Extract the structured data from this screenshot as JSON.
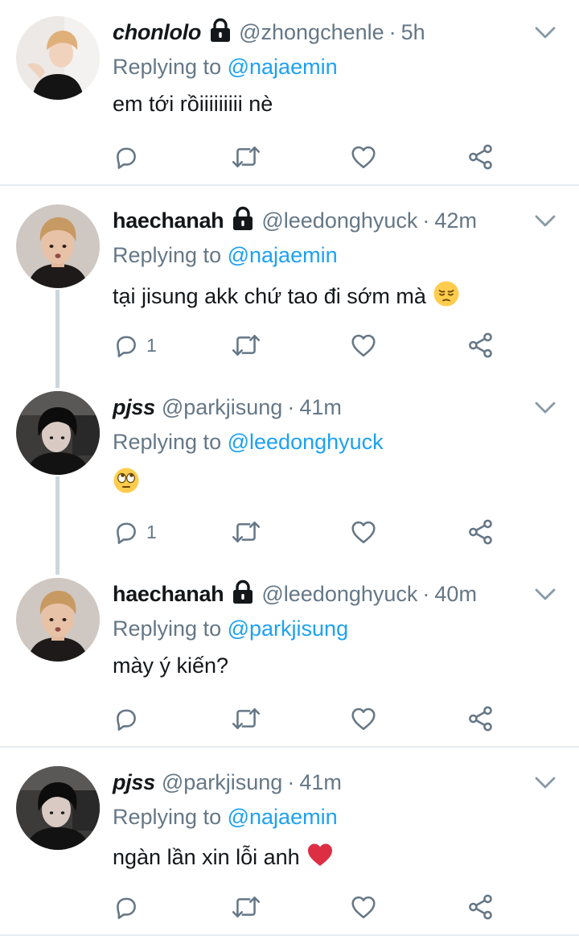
{
  "tweets": [
    {
      "name": "chonlolo",
      "handle": "@zhongchenle",
      "time": "5h",
      "locked": true,
      "replying_prefix": "Replying to",
      "replying_to": "@najaemin",
      "text": "em tới rồiiiiiiiii nè",
      "emoji": "",
      "reply_count": ""
    },
    {
      "name": "haechanah",
      "handle": "@leedonghyuck",
      "time": "42m",
      "locked": true,
      "replying_prefix": "Replying to",
      "replying_to": "@najaemin",
      "text": "tại jisung akk chứ tao đi sớm mà",
      "emoji": "pensive-face",
      "reply_count": "1"
    },
    {
      "name": "pjss",
      "handle": "@parkjisung",
      "time": "41m",
      "locked": false,
      "replying_prefix": "Replying to",
      "replying_to": "@leedonghyuck",
      "text": "",
      "emoji": "eye-roll-face",
      "reply_count": "1"
    },
    {
      "name": "haechanah",
      "handle": "@leedonghyuck",
      "time": "40m",
      "locked": true,
      "replying_prefix": "Replying to",
      "replying_to": "@parkjisung",
      "text": "mày ý kiến?",
      "emoji": "",
      "reply_count": ""
    },
    {
      "name": "pjss",
      "handle": "@parkjisung",
      "time": "41m",
      "locked": false,
      "replying_prefix": "Replying to",
      "replying_to": "@najaemin",
      "text": "ngàn lần xin lỗi anh",
      "emoji": "red-heart",
      "reply_count": ""
    }
  ],
  "colors": {
    "accent": "#1da1f2",
    "secondary_text": "#657786",
    "primary_text": "#14171a",
    "divider": "#e6ecf0",
    "thread_line": "#ccd6dd"
  }
}
